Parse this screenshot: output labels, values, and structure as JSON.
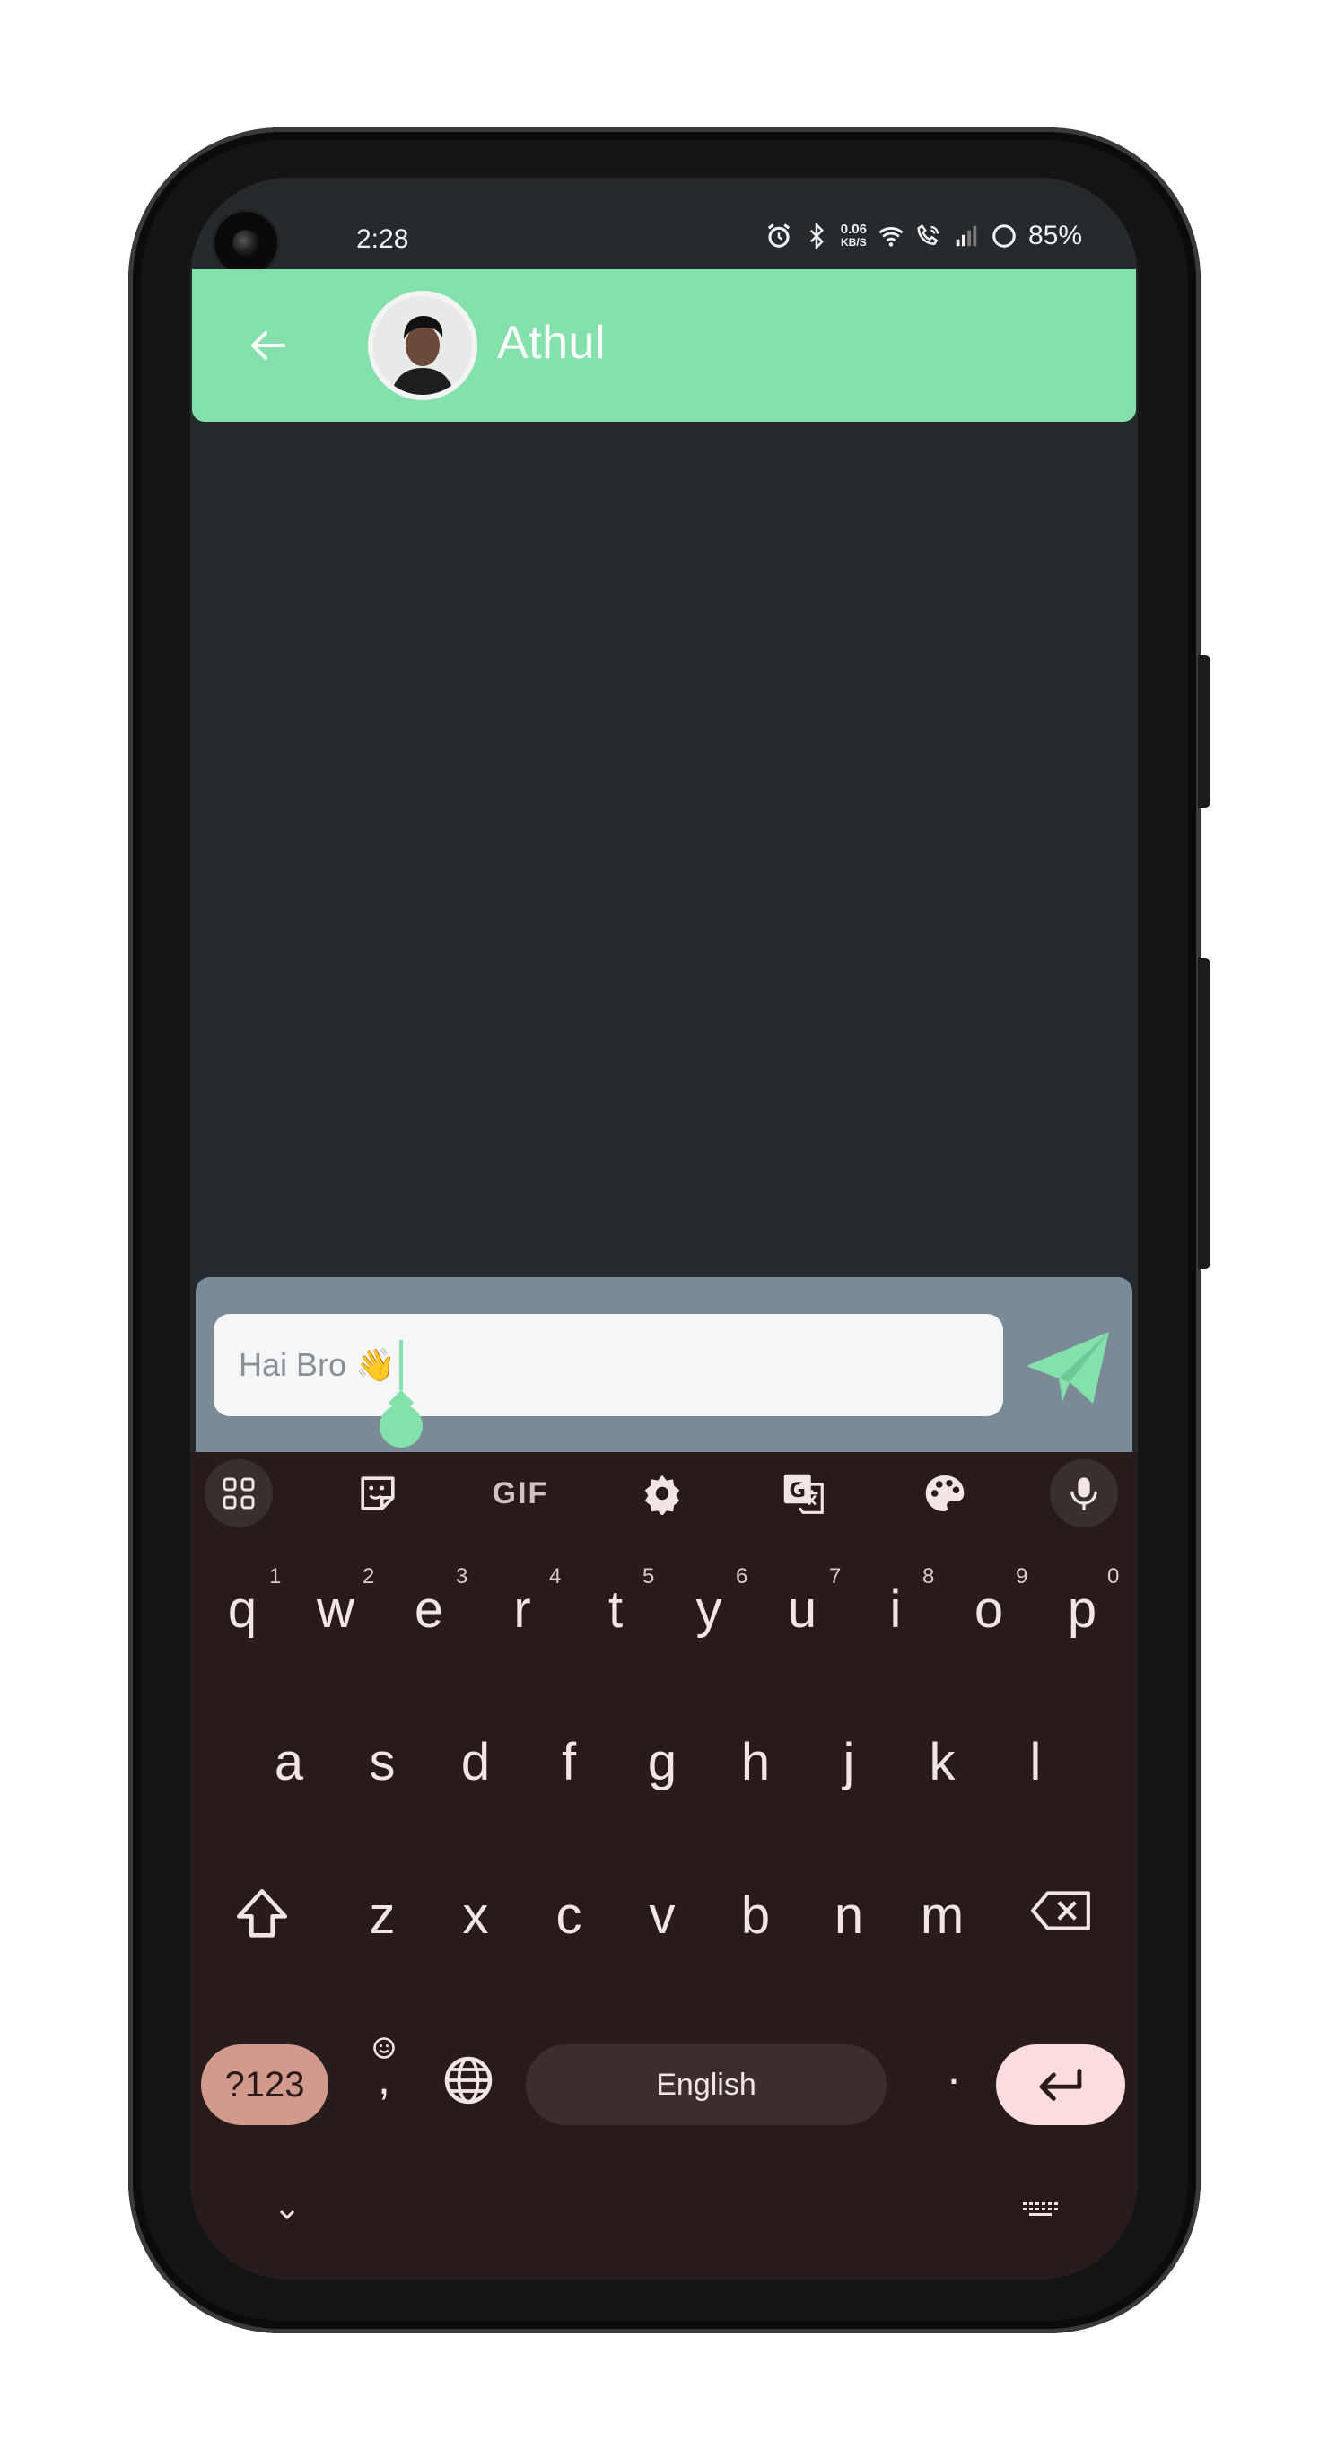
{
  "status_bar": {
    "time": "2:28",
    "netspeed_value": "0.06",
    "netspeed_unit": "KB/S",
    "battery": "85%",
    "icons": [
      "alarm-icon",
      "bluetooth-icon",
      "wifi-icon",
      "wifi-call-icon",
      "signal-icon",
      "battery-ring-icon"
    ]
  },
  "header": {
    "back_icon": "arrow-left-icon",
    "contact_name": "Athul",
    "accent": "#84e1ab"
  },
  "composer": {
    "input_value": "Hai Bro 👋",
    "send_icon": "paper-plane-icon"
  },
  "keyboard": {
    "toolbar": [
      "apps-grid-icon",
      "sticker-icon",
      "gif-icon",
      "settings-icon",
      "translate-icon",
      "palette-icon",
      "microphone-icon"
    ],
    "gif_label": "GIF",
    "row1": [
      "q",
      "w",
      "e",
      "r",
      "t",
      "y",
      "u",
      "i",
      "o",
      "p"
    ],
    "row1_hints": [
      "1",
      "2",
      "3",
      "4",
      "5",
      "6",
      "7",
      "8",
      "9",
      "0"
    ],
    "row2": [
      "a",
      "s",
      "d",
      "f",
      "g",
      "h",
      "j",
      "k",
      "l"
    ],
    "row3": [
      "z",
      "x",
      "c",
      "v",
      "b",
      "n",
      "m"
    ],
    "symbols_label": "?123",
    "comma_label": ",",
    "space_label": "English",
    "period_label": ".",
    "bottom_icons": [
      "chevron-down-icon",
      "keyboard-icon"
    ]
  }
}
